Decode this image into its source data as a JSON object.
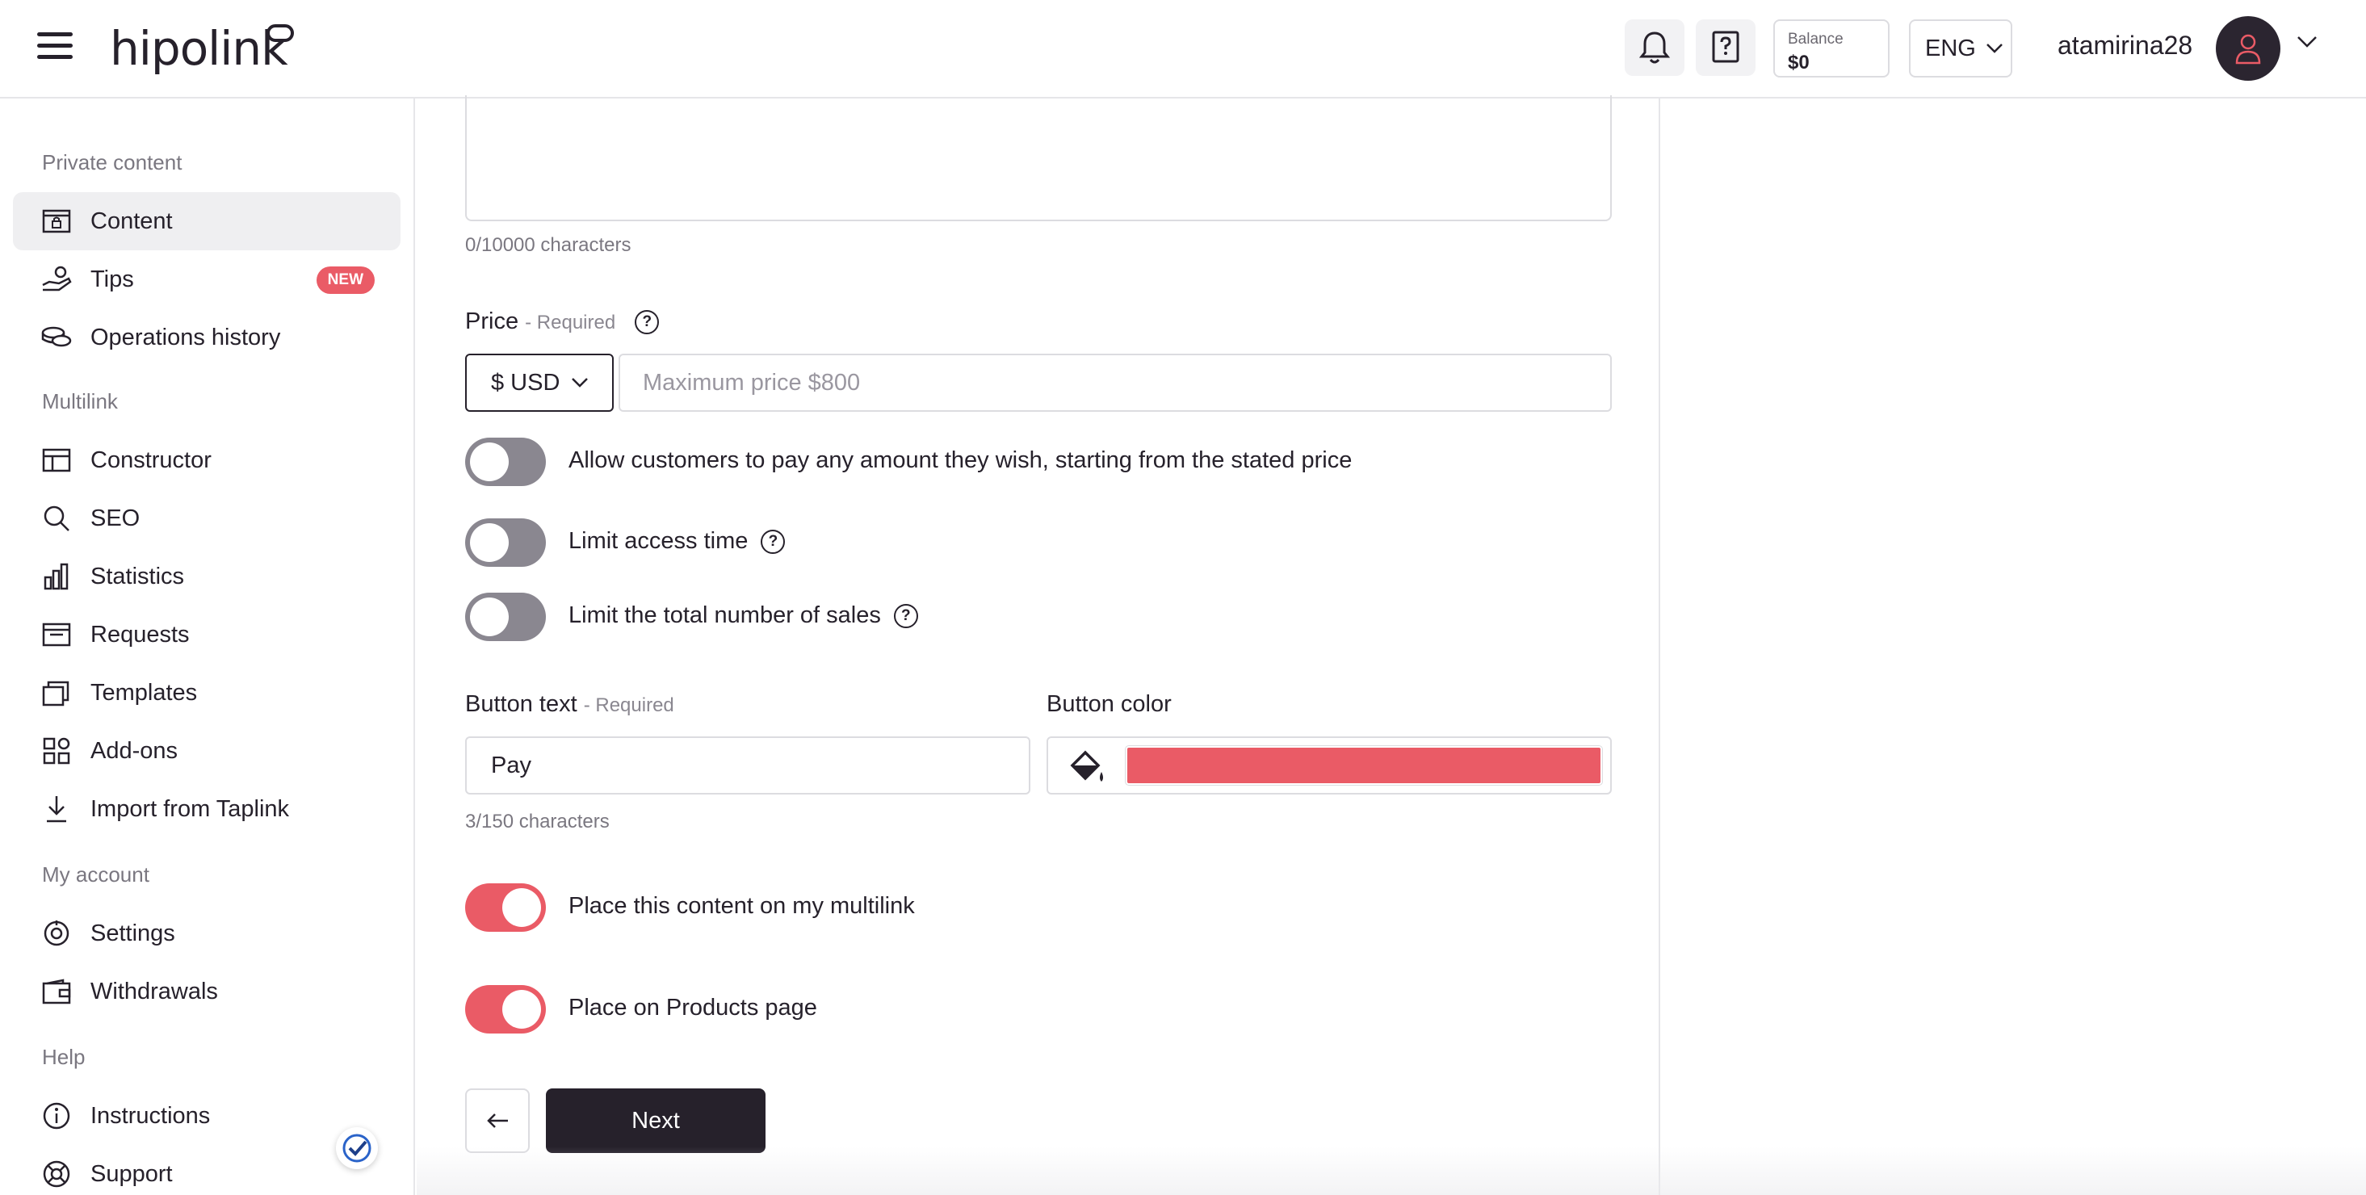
{
  "header": {
    "logo_text": "hipolink",
    "balance_label": "Balance",
    "balance_value": "$0",
    "language": "ENG",
    "username": "atamirina28"
  },
  "sidebar": {
    "sections": [
      {
        "title": "Private content"
      },
      {
        "title": "Multilink"
      },
      {
        "title": "My account"
      },
      {
        "title": "Help"
      }
    ],
    "items": [
      {
        "label": "Content",
        "icon": "lock-box-icon",
        "active": true
      },
      {
        "label": "Tips",
        "icon": "hand-coins-icon",
        "badge": "NEW"
      },
      {
        "label": "Operations history",
        "icon": "coins-icon"
      },
      {
        "label": "Constructor",
        "icon": "layout-icon"
      },
      {
        "label": "SEO",
        "icon": "search-icon"
      },
      {
        "label": "Statistics",
        "icon": "bar-chart-icon"
      },
      {
        "label": "Requests",
        "icon": "inbox-icon"
      },
      {
        "label": "Templates",
        "icon": "templates-icon"
      },
      {
        "label": "Add-ons",
        "icon": "addons-icon"
      },
      {
        "label": "Import from Taplink",
        "icon": "download-icon"
      },
      {
        "label": "Settings",
        "icon": "gear-icon"
      },
      {
        "label": "Withdrawals",
        "icon": "wallet-icon"
      },
      {
        "label": "Instructions",
        "icon": "info-icon"
      },
      {
        "label": "Support",
        "icon": "lifebuoy-icon"
      }
    ]
  },
  "form": {
    "description_counter": "0/10000 characters",
    "price_label": "Price",
    "price_required": "- Required",
    "currency": "$ USD",
    "price_placeholder": "Maximum price $800",
    "toggles": [
      {
        "label": "Allow customers to pay any amount they wish, starting from the stated price",
        "on": false
      },
      {
        "label": "Limit access time",
        "on": false,
        "help": true
      },
      {
        "label": "Limit the total number of sales",
        "on": false,
        "help": true
      },
      {
        "label": "Place this content on my multilink",
        "on": true
      },
      {
        "label": "Place on Products page",
        "on": true
      }
    ],
    "button_text_label": "Button text",
    "button_text_required": "- Required",
    "button_text_value": "Pay",
    "button_text_counter": "3/150 characters",
    "button_color_label": "Button color",
    "button_color_value": "#ea5b66",
    "next_label": "Next"
  },
  "colors": {
    "accent": "#ea5b66",
    "dark": "#26212b",
    "toggle_off": "#8a8790"
  }
}
